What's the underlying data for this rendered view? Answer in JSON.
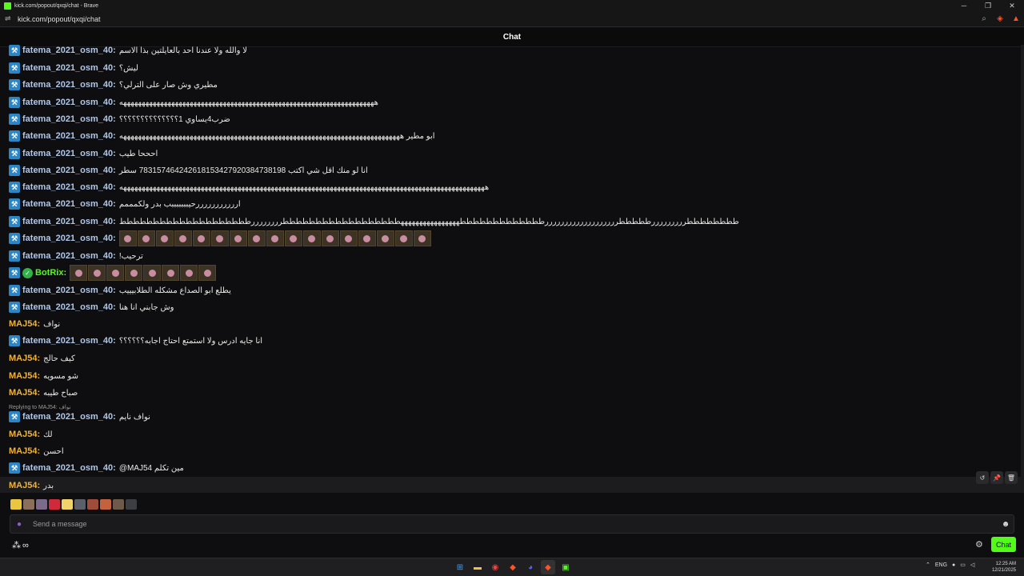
{
  "window": {
    "title": "kick.com/popout/qxqi/chat - Brave",
    "minimize": "─",
    "maximize": "❐",
    "close": "✕"
  },
  "address": {
    "url": "kick.com/popout/qxqi/chat",
    "site_icon": "site-info-icon",
    "zoom_icon": "zoom-icon",
    "brave_icon": "brave-shields-icon",
    "rewards_icon": "brave-rewards-icon"
  },
  "header": {
    "title": "Chat"
  },
  "messages": [
    {
      "user": "fatema_2021_osm_40:",
      "text": "لا والله ولا عندنا احد بالعايلتين بذا الاسم"
    },
    {
      "user": "fatema_2021_osm_40:",
      "text": "ليش؟"
    },
    {
      "user": "fatema_2021_osm_40:",
      "text": "مطيري وش صار على الترلي؟"
    },
    {
      "user": "fatema_2021_osm_40:",
      "text": "هههههههههههههههههههههههههههههههههههههههههههههههههههههههههههههههههههههه"
    },
    {
      "user": "fatema_2021_osm_40:",
      "text": "ضرب4يساوي 1؟؟؟؟؟؟؟؟؟؟؟؟؟؟"
    },
    {
      "user": "fatema_2021_osm_40:",
      "text": "ابو مطير ههههههههههههههههههههههههههههههههههههههههههههههههههههههههههههههههههههههههههههه"
    },
    {
      "user": "fatema_2021_osm_40:",
      "text": "احححا طيب"
    },
    {
      "user": "fatema_2021_osm_40:",
      "text": "انا لو منك اقل شي اكتب 7831574642426181534279203847381​98 سطر"
    },
    {
      "user": "fatema_2021_osm_40:",
      "text": "هههههههههههههههههههههههههههههههههههههههههههههههههههههههههههههههههههههههههههههههههههههههههههههههههههه"
    },
    {
      "user": "fatema_2021_osm_40:",
      "text": "ارررررررررررحيبببببببب بدر ولكمممم"
    },
    {
      "user": "fatema_2021_osm_40:",
      "text": "ططططططططرررررررررطططططرررررررررررررررررررطططططططططططططههههههههههههههههططططططططططططططططططررررررررطططططططططططططططططططط"
    },
    {
      "user": "fatema_2021_osm_40:",
      "emotes": 17
    },
    {
      "user": "fatema_2021_osm_40:",
      "text": "ترحيب!"
    },
    {
      "user": "BotRix:",
      "emotes": 8
    },
    {
      "user": "fatema_2021_osm_40:",
      "text": "يطلع ابو الصداع مشكله الطلابيييب"
    },
    {
      "user": "fatema_2021_osm_40:",
      "text": "وش جابني انا هنا"
    },
    {
      "user": "MAJ54:",
      "text": "نواف"
    },
    {
      "user": "fatema_2021_osm_40:",
      "text": "انا جايه ادرس ولا استمتع احتاج اجابه؟؟؟؟؟؟"
    },
    {
      "user": "MAJ54:",
      "text": "كيف حالج"
    },
    {
      "user": "MAJ54:",
      "text": "شو مسويه"
    },
    {
      "user": "MAJ54:",
      "text": "صباح طيبه"
    },
    {
      "user": "fatema_2021_osm_40:",
      "text": "نواف نايم"
    },
    {
      "user": "MAJ54:",
      "text": "لك"
    },
    {
      "user": "MAJ54:",
      "text": "احسن"
    },
    {
      "user": "fatema_2021_osm_40:",
      "text": "@MAJ54 مين تكلم"
    },
    {
      "user": "MAJ54:",
      "text": "بدر"
    }
  ],
  "reply_hint": "Replying to MAJ54: نواف",
  "message_actions": [
    "↺",
    "📌",
    "🗑"
  ],
  "input": {
    "placeholder": "Send a message"
  },
  "bottom": {
    "points": "∞",
    "chat_button": "Chat"
  },
  "taskbar": {
    "lang": "ENG",
    "time": "12:25 AM",
    "date": "12/21/2025"
  },
  "colors": {
    "accent": "#53fc18",
    "user_blue": "#b0c7e8",
    "user_orange": "#f0b33a",
    "bot_green": "#53fc18"
  }
}
